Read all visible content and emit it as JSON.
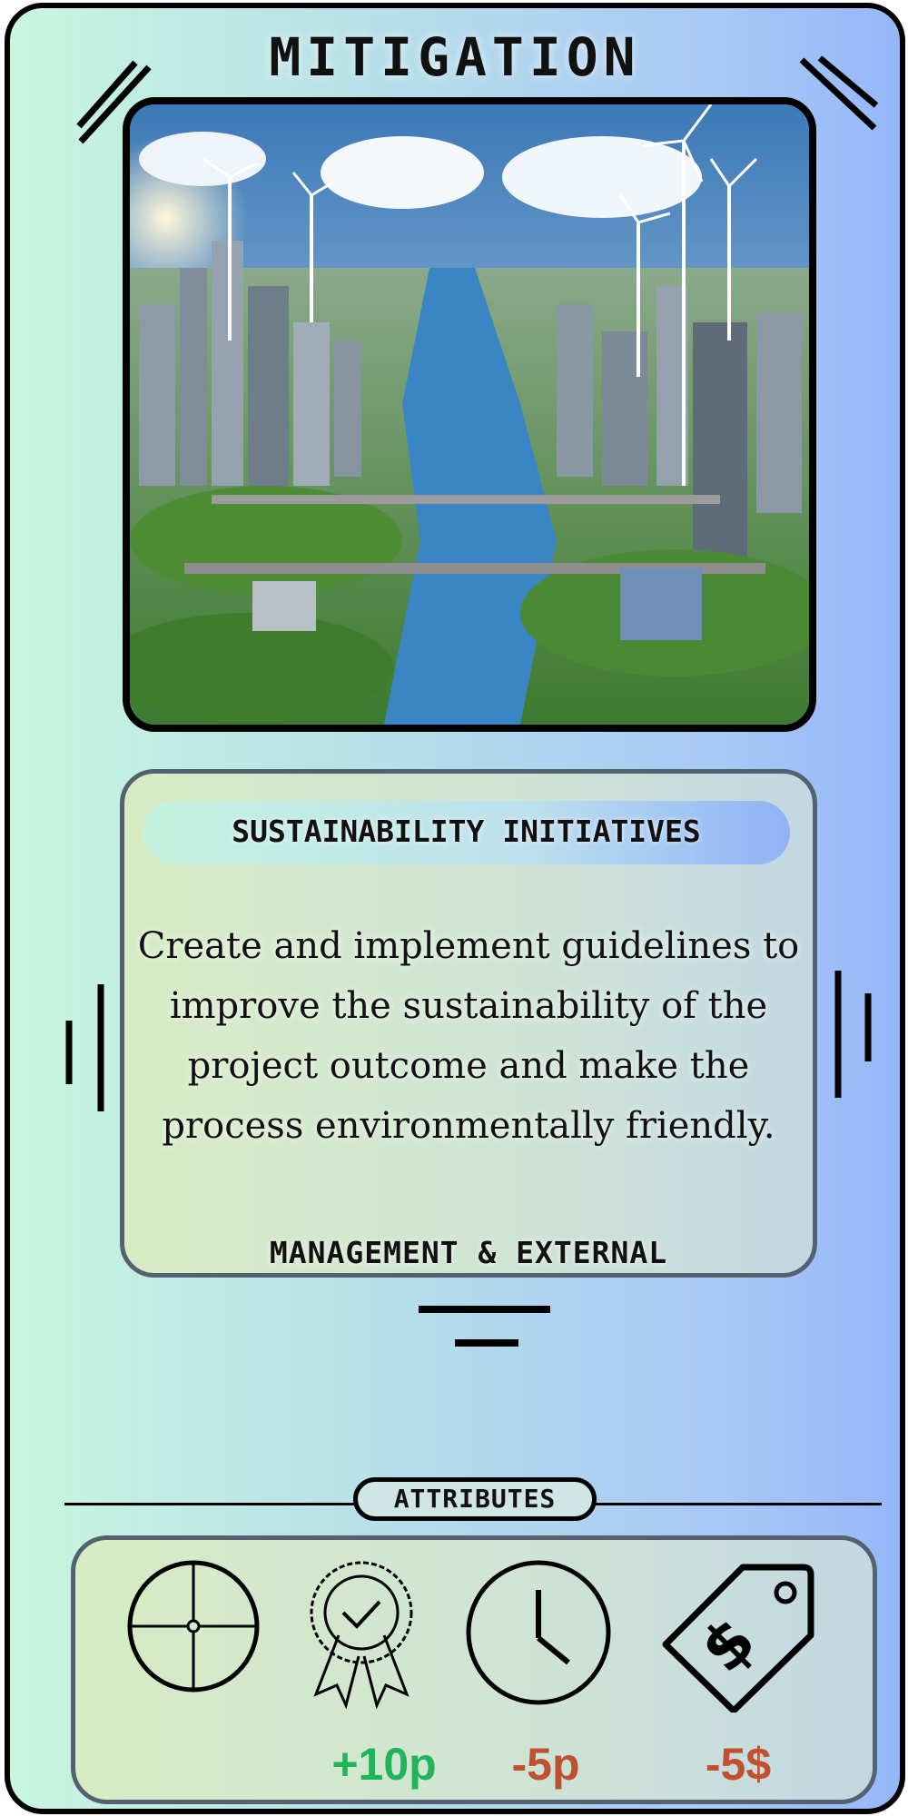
{
  "card": {
    "title": "MITIGATION",
    "subtitle": "SUSTAINABILITY INITIATIVES",
    "description": "Create and implement guidelines to improve the sustainability of the project outcome and make the process environmentally friendly.",
    "category": "MANAGEMENT & EXTERNAL"
  },
  "attributes": {
    "label": "ATTRIBUTES",
    "items": [
      {
        "icon": "crosshair-icon",
        "value": "",
        "color": "#222222"
      },
      {
        "icon": "award-ribbon-icon",
        "value": "+10p",
        "color": "#22b45a"
      },
      {
        "icon": "clock-icon",
        "value": "-5p",
        "color": "#c0502e"
      },
      {
        "icon": "price-tag-dollar-icon",
        "value": "-5$",
        "color": "#c0502e"
      }
    ]
  },
  "colors": {
    "card_border": "#000000",
    "gradient_left": "#c8f6df",
    "gradient_right": "#96b7f8",
    "positive": "#22b45a",
    "negative": "#c0502e"
  }
}
